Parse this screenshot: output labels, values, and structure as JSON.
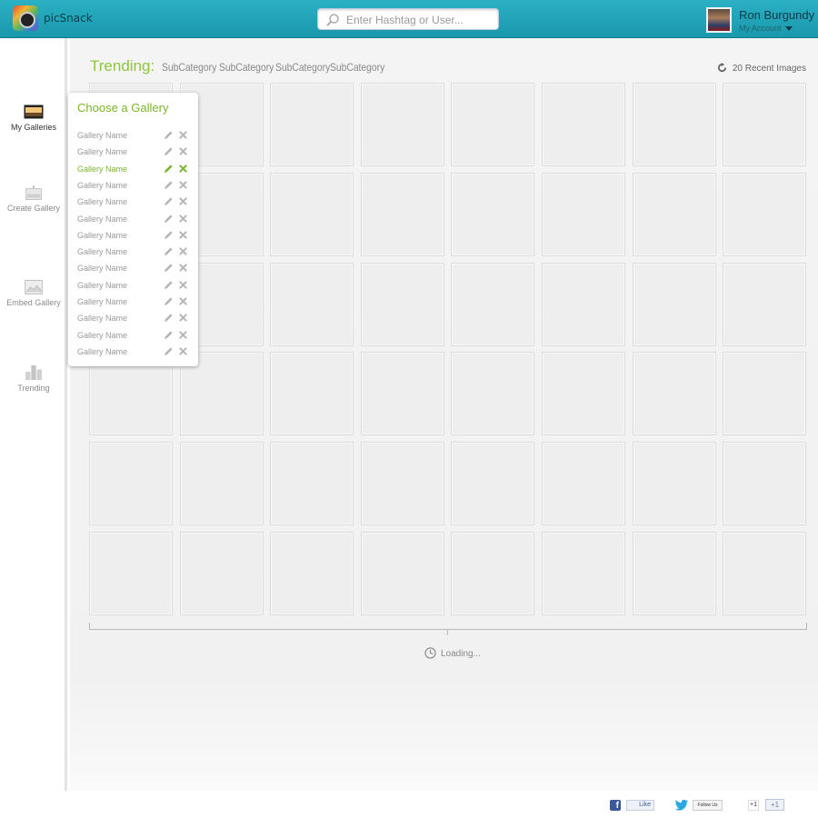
{
  "header": {
    "logo_text": "picSnack",
    "search_placeholder": "Enter Hashtag or User...",
    "user_name": "Ron Burgundy",
    "account_label": "My Account"
  },
  "sidebar": {
    "items": [
      {
        "label": "My Galleries",
        "icon": "galleries-icon"
      },
      {
        "label": "Create Gallery",
        "icon": "create-gallery-icon"
      },
      {
        "label": "Embed Gallery",
        "icon": "embed-gallery-icon"
      },
      {
        "label": "Trending",
        "icon": "trending-icon"
      }
    ]
  },
  "main": {
    "trending_label": "Trending:",
    "subcategories": [
      "SubCategory",
      "SubCategory",
      "SubCategory",
      "SubCategory"
    ],
    "recent_label": "20 Recent Images",
    "loading_label": "Loading...",
    "grid": {
      "rows": 6,
      "cols": 8
    }
  },
  "popup": {
    "title": "Choose a Gallery",
    "galleries": [
      {
        "name": "Gallery Name",
        "active": false
      },
      {
        "name": "Gallery Name",
        "active": false
      },
      {
        "name": "Gallery Name",
        "active": true
      },
      {
        "name": "Gallery Name",
        "active": false
      },
      {
        "name": "Gallery Name",
        "active": false
      },
      {
        "name": "Gallery Name",
        "active": false
      },
      {
        "name": "Gallery Name",
        "active": false
      },
      {
        "name": "Gallery Name",
        "active": false
      },
      {
        "name": "Gallery Name",
        "active": false
      },
      {
        "name": "Gallery Name",
        "active": false
      },
      {
        "name": "Gallery Name",
        "active": false
      },
      {
        "name": "Gallery Name",
        "active": false
      },
      {
        "name": "Gallery Name",
        "active": false
      },
      {
        "name": "Gallery Name",
        "active": false
      }
    ]
  },
  "footer": {
    "facebook_icon": "f",
    "facebook_like": "Like",
    "twitter_follow": "Follow Us",
    "google_icon": "+1",
    "google_plus": "+1"
  },
  "colors": {
    "header": "#1fa3b7",
    "accent_green": "#8dc63f",
    "tile": "#eeeeee"
  }
}
